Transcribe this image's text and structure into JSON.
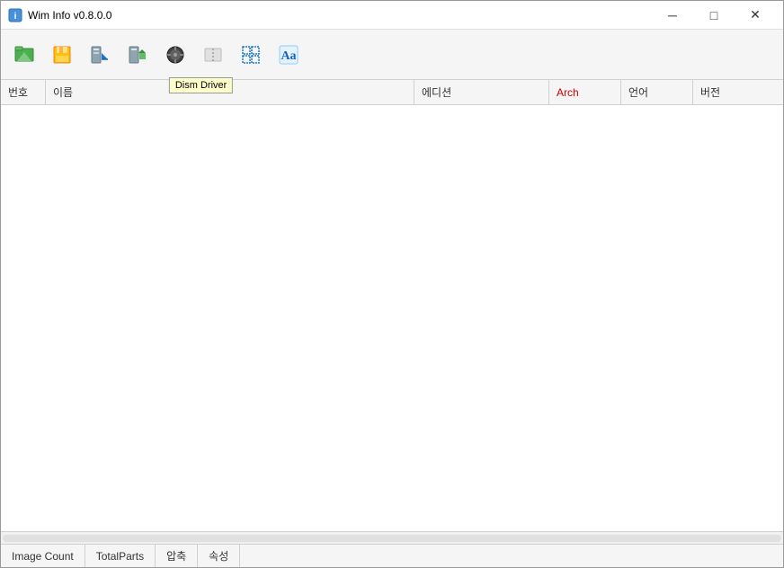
{
  "window": {
    "title": "Wim Info v0.8.0.0",
    "icon": "info-icon"
  },
  "titlebar": {
    "minimize_label": "─",
    "maximize_label": "□",
    "close_label": "✕"
  },
  "toolbar": {
    "buttons": [
      {
        "name": "open-button",
        "icon": "open-icon",
        "tooltip": ""
      },
      {
        "name": "save-button",
        "icon": "save-icon",
        "tooltip": ""
      },
      {
        "name": "extract-button",
        "icon": "extract-icon",
        "tooltip": ""
      },
      {
        "name": "export-button",
        "icon": "export-icon",
        "tooltip": ""
      },
      {
        "name": "dism-driver-button",
        "icon": "dism-driver-icon",
        "tooltip": "Dism Driver"
      },
      {
        "name": "wim-split-button",
        "icon": "wim-split-icon",
        "tooltip": ""
      },
      {
        "name": "select-all-button",
        "icon": "select-all-icon",
        "tooltip": ""
      },
      {
        "name": "font-button",
        "icon": "font-icon",
        "tooltip": ""
      }
    ]
  },
  "table": {
    "columns": [
      {
        "key": "num",
        "label": "번호"
      },
      {
        "key": "name",
        "label": "이름"
      },
      {
        "key": "edition",
        "label": "에디션"
      },
      {
        "key": "arch",
        "label": "Arch"
      },
      {
        "key": "lang",
        "label": "언어"
      },
      {
        "key": "version",
        "label": "버전"
      }
    ],
    "rows": []
  },
  "statusbar": {
    "items": [
      {
        "key": "image-count",
        "label": "Image Count"
      },
      {
        "key": "total-parts",
        "label": "TotalParts"
      },
      {
        "key": "compress",
        "label": "압축"
      },
      {
        "key": "properties",
        "label": "속성"
      }
    ]
  },
  "tooltip": {
    "dism_driver": "Dism Driver"
  }
}
